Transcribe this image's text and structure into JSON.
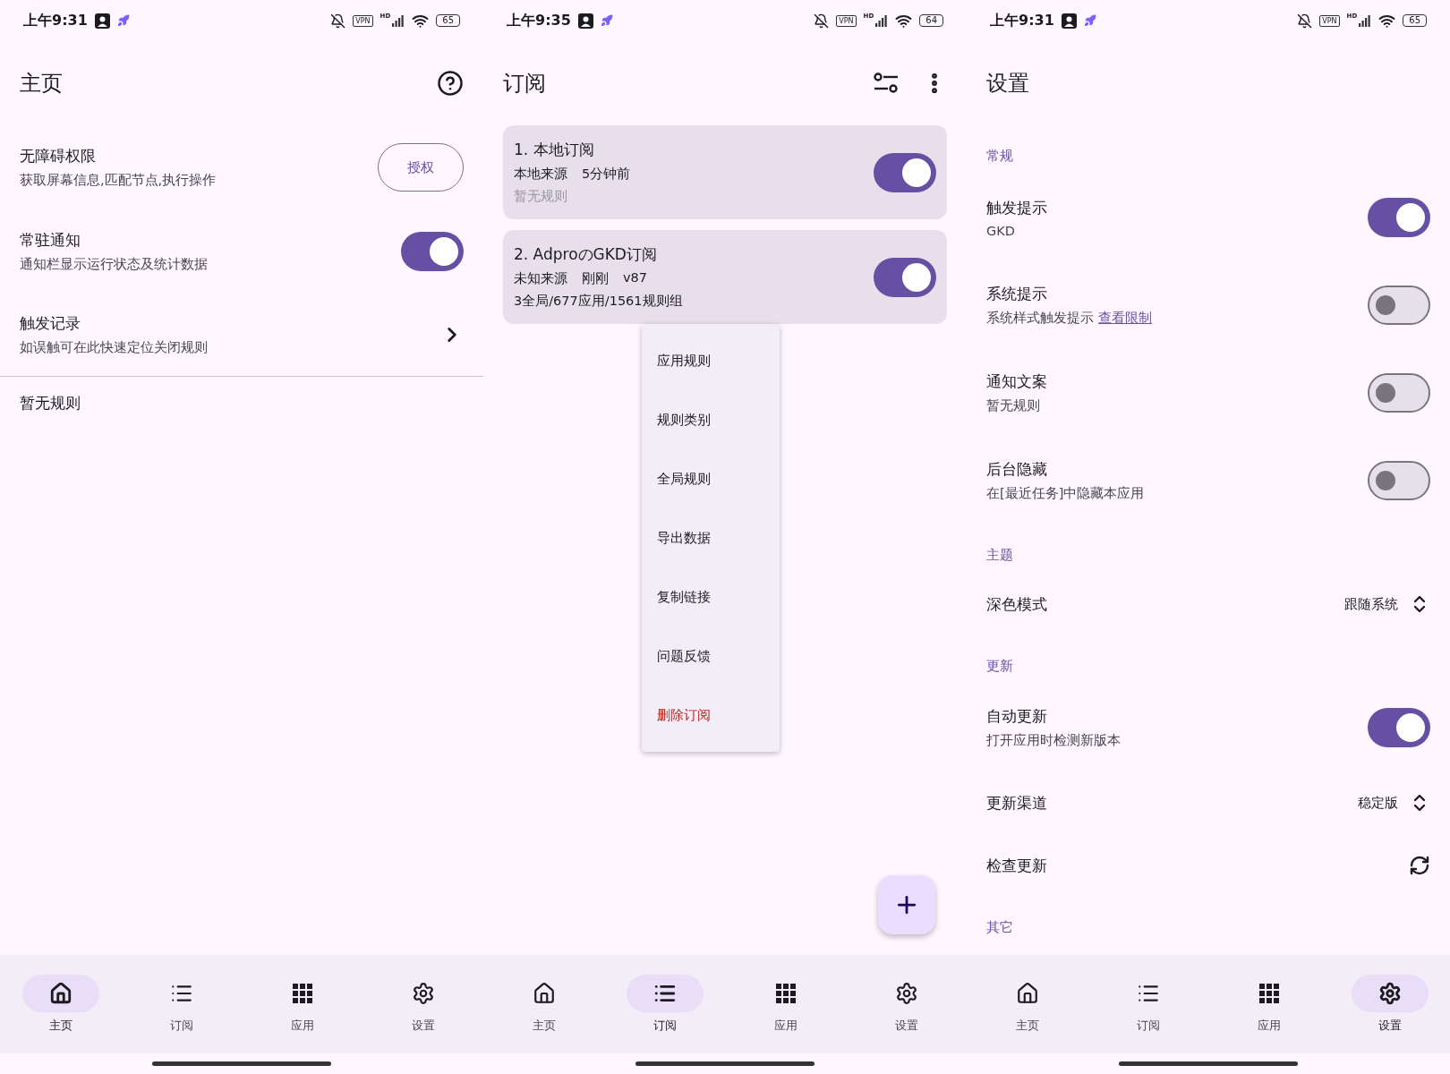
{
  "home_screen": {
    "status_bar": {
      "time": "上午9:31",
      "vpn": "VPN",
      "signal_label": "HD",
      "battery": "65"
    },
    "title": "主页",
    "rows": [
      {
        "kind": "button",
        "title": "无障碍权限",
        "subtitle": "获取屏幕信息,匹配节点,执行操作",
        "button_label": "授权"
      },
      {
        "kind": "switch",
        "title": "常驻通知",
        "subtitle": "通知栏显示运行状态及统计数据",
        "on": true
      },
      {
        "kind": "link",
        "title": "触发记录",
        "subtitle": "如误触可在此快速定位关闭规则"
      }
    ],
    "empty_text": "暂无规则",
    "nav_items": [
      {
        "label": "主页",
        "selected": true
      },
      {
        "label": "订阅",
        "selected": false
      },
      {
        "label": "应用",
        "selected": false
      },
      {
        "label": "设置",
        "selected": false
      }
    ]
  },
  "subscriptions_screen": {
    "status_bar": {
      "time": "上午9:35",
      "vpn": "VPN",
      "signal_label": "HD",
      "battery": "64"
    },
    "title": "订阅",
    "cards": [
      {
        "title": "1. 本地订阅",
        "meta": [
          "本地来源",
          "5分钟前"
        ],
        "summary": "暂无规则",
        "summary_muted": true,
        "on": true
      },
      {
        "title": "2. AdproのGKD订阅",
        "meta": [
          "未知来源",
          "刚刚",
          "v87"
        ],
        "summary": "3全局/677应用/1561规则组",
        "summary_muted": false,
        "on": true
      }
    ],
    "menu_items": [
      {
        "label": "应用规则",
        "danger": false
      },
      {
        "label": "规则类别",
        "danger": false
      },
      {
        "label": "全局规则",
        "danger": false
      },
      {
        "label": "导出数据",
        "danger": false
      },
      {
        "label": "复制链接",
        "danger": false
      },
      {
        "label": "问题反馈",
        "danger": false
      },
      {
        "label": "删除订阅",
        "danger": true
      }
    ],
    "nav_items": [
      {
        "label": "主页",
        "selected": false
      },
      {
        "label": "订阅",
        "selected": true
      },
      {
        "label": "应用",
        "selected": false
      },
      {
        "label": "设置",
        "selected": false
      }
    ]
  },
  "settings_screen": {
    "status_bar": {
      "time": "上午9:31",
      "vpn": "VPN",
      "signal_label": "HD",
      "battery": "65"
    },
    "title": "设置",
    "sections": [
      {
        "header": "常规",
        "items": [
          {
            "kind": "switch",
            "title": "触发提示",
            "subtitle": "GKD",
            "on": true
          },
          {
            "kind": "switch",
            "title": "系统提示",
            "subtitle": "系统样式触发提示",
            "link": "查看限制",
            "on": false
          },
          {
            "kind": "switch",
            "title": "通知文案",
            "subtitle": "暂无规则",
            "on": false
          },
          {
            "kind": "switch",
            "title": "后台隐藏",
            "subtitle": "在[最近任务]中隐藏本应用",
            "on": false
          }
        ]
      },
      {
        "header": "主题",
        "items": [
          {
            "kind": "select",
            "title": "深色模式",
            "value": "跟随系统"
          }
        ]
      },
      {
        "header": "更新",
        "items": [
          {
            "kind": "switch",
            "title": "自动更新",
            "subtitle": "打开应用时检测新版本",
            "on": true
          },
          {
            "kind": "select",
            "title": "更新渠道",
            "value": "稳定版"
          },
          {
            "kind": "action",
            "title": "检查更新"
          }
        ]
      },
      {
        "header": "其它"
      }
    ],
    "nav_items": [
      {
        "label": "主页",
        "selected": false
      },
      {
        "label": "订阅",
        "selected": false
      },
      {
        "label": "应用",
        "selected": false
      },
      {
        "label": "设置",
        "selected": true
      }
    ]
  }
}
